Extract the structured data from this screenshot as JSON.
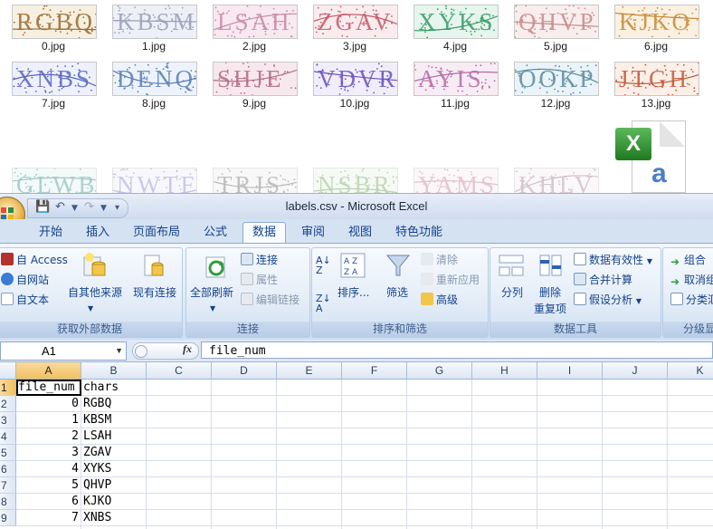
{
  "explorer": {
    "files": [
      {
        "name": "0.jpg",
        "code": "RGBQ",
        "bg": "#f7f0e1",
        "color": "#9a6a2e"
      },
      {
        "name": "1.jpg",
        "code": "KBSM",
        "bg": "#eef0f8",
        "color": "#9aa0b8"
      },
      {
        "name": "2.jpg",
        "code": "LSAH",
        "bg": "#f8e8ef",
        "color": "#c48aa8"
      },
      {
        "name": "3.jpg",
        "code": "ZGAV",
        "bg": "#faecee",
        "color": "#c25a6a"
      },
      {
        "name": "4.jpg",
        "code": "XYKS",
        "bg": "#e6f6ee",
        "color": "#3a9a66"
      },
      {
        "name": "5.jpg",
        "code": "QHVP",
        "bg": "#f9eeee",
        "color": "#c78a8a"
      },
      {
        "name": "6.jpg",
        "code": "KJKO",
        "bg": "#fbf1e1",
        "color": "#c78a3c"
      },
      {
        "name": "7.jpg",
        "code": "XNBS",
        "bg": "#eef0fb",
        "color": "#5a66c0"
      },
      {
        "name": "8.jpg",
        "code": "DENQ",
        "bg": "#eef3fb",
        "color": "#5a7fb8"
      },
      {
        "name": "9.jpg",
        "code": "SHJE",
        "bg": "#f7e8ee",
        "color": "#b46a86"
      },
      {
        "name": "10.jpg",
        "code": "VDVR",
        "bg": "#f1eefb",
        "color": "#6a4fc0"
      },
      {
        "name": "11.jpg",
        "code": "AYIS",
        "bg": "#f7ecf4",
        "color": "#b36aa4"
      },
      {
        "name": "12.jpg",
        "code": "OOKP",
        "bg": "#eaf3f7",
        "color": "#5a8aa0"
      },
      {
        "name": "13.jpg",
        "code": "JTGH",
        "bg": "#fbefe8",
        "color": "#c2583a"
      }
    ],
    "partial_row": [
      {
        "code": "GLWB",
        "bg": "#e6f4f2",
        "color": "#2f8a84"
      },
      {
        "code": "NWTF",
        "bg": "#f0f0fa",
        "color": "#7a7ac0"
      },
      {
        "code": "TRJS",
        "bg": "#f0f0f0",
        "color": "#666666"
      },
      {
        "code": "NSBR",
        "bg": "#ecf6e8",
        "color": "#6aa05a"
      },
      {
        "code": "YAMS",
        "bg": "#f9eef0",
        "color": "#c07a90"
      },
      {
        "code": "KHLV",
        "bg": "#f7f0f4",
        "color": "#a07890"
      }
    ]
  },
  "excel": {
    "window_title": "labels.csv - Microsoft Excel",
    "tabs": [
      "开始",
      "插入",
      "页面布局",
      "公式",
      "数据",
      "审阅",
      "视图",
      "特色功能"
    ],
    "active_tab": "数据",
    "ribbon": {
      "external_data": {
        "access": "自 Access",
        "web": "自网站",
        "text": "自文本",
        "other_sources": "自其他来源",
        "existing_connections": "现有连接",
        "label": "获取外部数据"
      },
      "connections": {
        "refresh_all": "全部刷新",
        "connections": "连接",
        "properties": "属性",
        "edit_links": "编辑链接",
        "label": "连接"
      },
      "sort_filter": {
        "sort": "排序...",
        "filter": "筛选",
        "clear": "清除",
        "reapply": "重新应用",
        "advanced": "高级",
        "label": "排序和筛选"
      },
      "data_tools": {
        "text_to_columns": "分列",
        "remove_duplicates_1": "删除",
        "remove_duplicates_2": "重复项",
        "data_validation": "数据有效性",
        "consolidate": "合并计算",
        "what_if": "假设分析",
        "label": "数据工具"
      },
      "outline": {
        "group": "组合",
        "ungroup": "取消组",
        "subtotal": "分类汇",
        "label": "分级显"
      }
    },
    "name_box": "A1",
    "fx": "fx",
    "formula": "file_num",
    "columns": [
      "A",
      "B",
      "C",
      "D",
      "E",
      "F",
      "G",
      "H",
      "I",
      "J",
      "K"
    ],
    "rows": [
      {
        "n": "1",
        "a": "file_num",
        "b": "chars"
      },
      {
        "n": "2",
        "a": "0",
        "b": "RGBQ"
      },
      {
        "n": "3",
        "a": "1",
        "b": "KBSM"
      },
      {
        "n": "4",
        "a": "2",
        "b": "LSAH"
      },
      {
        "n": "5",
        "a": "3",
        "b": "ZGAV"
      },
      {
        "n": "6",
        "a": "4",
        "b": "XYKS"
      },
      {
        "n": "7",
        "a": "5",
        "b": "QHVP"
      },
      {
        "n": "8",
        "a": "6",
        "b": "KJKO"
      },
      {
        "n": "9",
        "a": "7",
        "b": "XNBS"
      }
    ]
  }
}
